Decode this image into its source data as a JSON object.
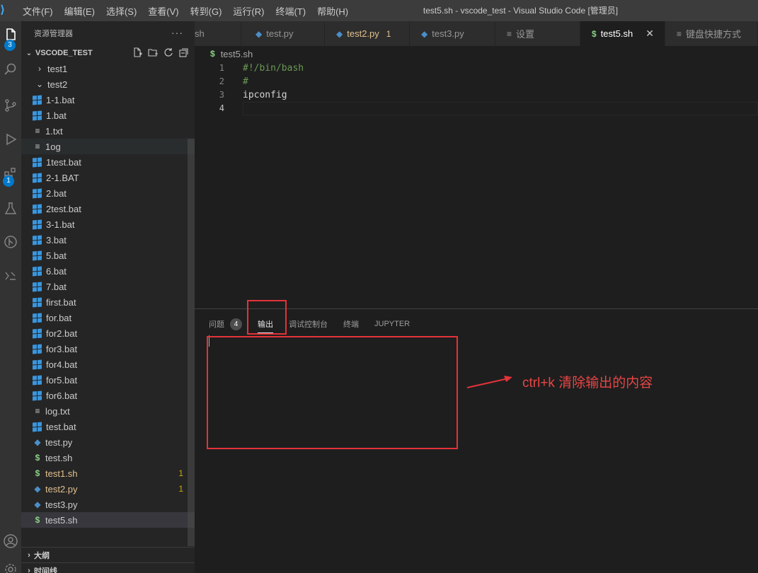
{
  "window": {
    "title": "test5.sh - vscode_test - Visual Studio Code [管理员]",
    "menu": [
      "文件(F)",
      "编辑(E)",
      "选择(S)",
      "查看(V)",
      "转到(G)",
      "运行(R)",
      "终端(T)",
      "帮助(H)"
    ]
  },
  "activity_bar": {
    "explorer_badge": "3",
    "extensions_badge": "1",
    "icons": [
      "files-icon",
      "search-icon",
      "source-control-icon",
      "run-debug-icon",
      "extensions-icon",
      "testing-icon",
      "git-graph-icon",
      "remote-icon",
      "account-icon",
      "settings-gear-icon"
    ]
  },
  "sidebar": {
    "header": "资源管理器",
    "more": "···",
    "section": "VSCODE_TEST",
    "outline": "大纲",
    "timeline": "时间线",
    "items": [
      {
        "name": "test1",
        "type": "folder-collapsed"
      },
      {
        "name": "test2",
        "type": "folder-open"
      },
      {
        "name": "1-1.bat",
        "type": "bat"
      },
      {
        "name": "1.bat",
        "type": "bat"
      },
      {
        "name": "1.txt",
        "type": "txt"
      },
      {
        "name": "1og",
        "type": "txt"
      },
      {
        "name": "1test.bat",
        "type": "bat"
      },
      {
        "name": "2-1.BAT",
        "type": "bat"
      },
      {
        "name": "2.bat",
        "type": "bat"
      },
      {
        "name": "2test.bat",
        "type": "bat"
      },
      {
        "name": "3-1.bat",
        "type": "bat"
      },
      {
        "name": "3.bat",
        "type": "bat"
      },
      {
        "name": "5.bat",
        "type": "bat"
      },
      {
        "name": "6.bat",
        "type": "bat"
      },
      {
        "name": "7.bat",
        "type": "bat"
      },
      {
        "name": "first.bat",
        "type": "bat"
      },
      {
        "name": "for.bat",
        "type": "bat"
      },
      {
        "name": "for2.bat",
        "type": "bat"
      },
      {
        "name": "for3.bat",
        "type": "bat"
      },
      {
        "name": "for4.bat",
        "type": "bat"
      },
      {
        "name": "for5.bat",
        "type": "bat"
      },
      {
        "name": "for6.bat",
        "type": "bat"
      },
      {
        "name": "log.txt",
        "type": "txt"
      },
      {
        "name": "test.bat",
        "type": "bat"
      },
      {
        "name": "test.py",
        "type": "py"
      },
      {
        "name": "test.sh",
        "type": "sh"
      },
      {
        "name": "test1.sh",
        "type": "sh",
        "count": "1"
      },
      {
        "name": "test2.py",
        "type": "py",
        "count": "1"
      },
      {
        "name": "test3.py",
        "type": "py"
      },
      {
        "name": "test5.sh",
        "type": "sh"
      }
    ]
  },
  "tabs": [
    {
      "label": "sh"
    },
    {
      "label": "test.py",
      "icon": "py"
    },
    {
      "label": "test2.py",
      "icon": "py",
      "count": "1"
    },
    {
      "label": "test3.py",
      "icon": "py"
    },
    {
      "label": "设置",
      "icon": "settings"
    },
    {
      "label": "test5.sh",
      "icon": "sh",
      "close": "✕"
    },
    {
      "label": "键盘快捷方式",
      "icon": "settings"
    }
  ],
  "breadcrumb": "test5.sh",
  "editor": {
    "lines": [
      {
        "n": "1",
        "text": "#!/bin/bash"
      },
      {
        "n": "2",
        "text": "#"
      },
      {
        "n": "3",
        "text": "ipconfig"
      },
      {
        "n": "4",
        "text": ""
      }
    ]
  },
  "panel": {
    "tabs": [
      "问题",
      "输出",
      "调试控制台",
      "终端",
      "JUPYTER"
    ],
    "problems_count": "4"
  },
  "annotation": {
    "text": "ctrl+k  清除输出的内容",
    "color": "#e3323a"
  },
  "colors": {
    "accent": "#007acc",
    "modified": "#e2c08d",
    "shell": "#89d185",
    "python": "#4a8fc8"
  }
}
